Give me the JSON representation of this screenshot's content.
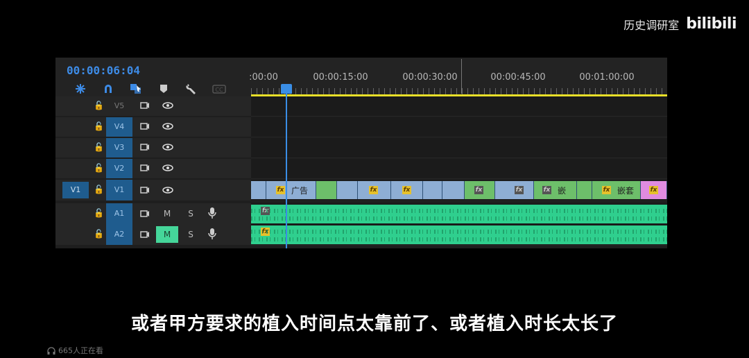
{
  "watermark": {
    "channel": "历史调研室",
    "logo": "bilibili"
  },
  "timeline": {
    "timecode": "00:00:06:04",
    "tools": [
      "insert-overwrite-icon",
      "snap-magnet-icon",
      "linked-selection-icon",
      "add-marker-icon",
      "wrench-icon",
      "captions-icon"
    ],
    "ruler_labels": [
      ":00:00",
      "00:00:15:00",
      "00:00:30:00",
      "00:00:45:00",
      "00:01:00:00"
    ],
    "tracks": {
      "v5": "V5",
      "v4": "V4",
      "v3": "V3",
      "v2": "V2",
      "v1": "V1",
      "source_v1": "V1",
      "a1": "A1",
      "a2": "A2",
      "mute_label": "M",
      "solo_label": "S"
    },
    "clips": {
      "ad_label": "广告",
      "embed_label": "嵌",
      "nest_label": "嵌套",
      "fx_label": "fx"
    },
    "colors": {
      "timecode": "#3d8be6",
      "video_clip": "#8eaed4",
      "video_clip_green": "#6dbf6a",
      "audio_clip": "#2fcf8e",
      "work_area": "#e8df28",
      "playhead": "#3a8ee6"
    }
  },
  "subtitle": "或者甲方要求的植入时间点太靠前了、或者植入时长太长了",
  "viewers": "665人正在看"
}
